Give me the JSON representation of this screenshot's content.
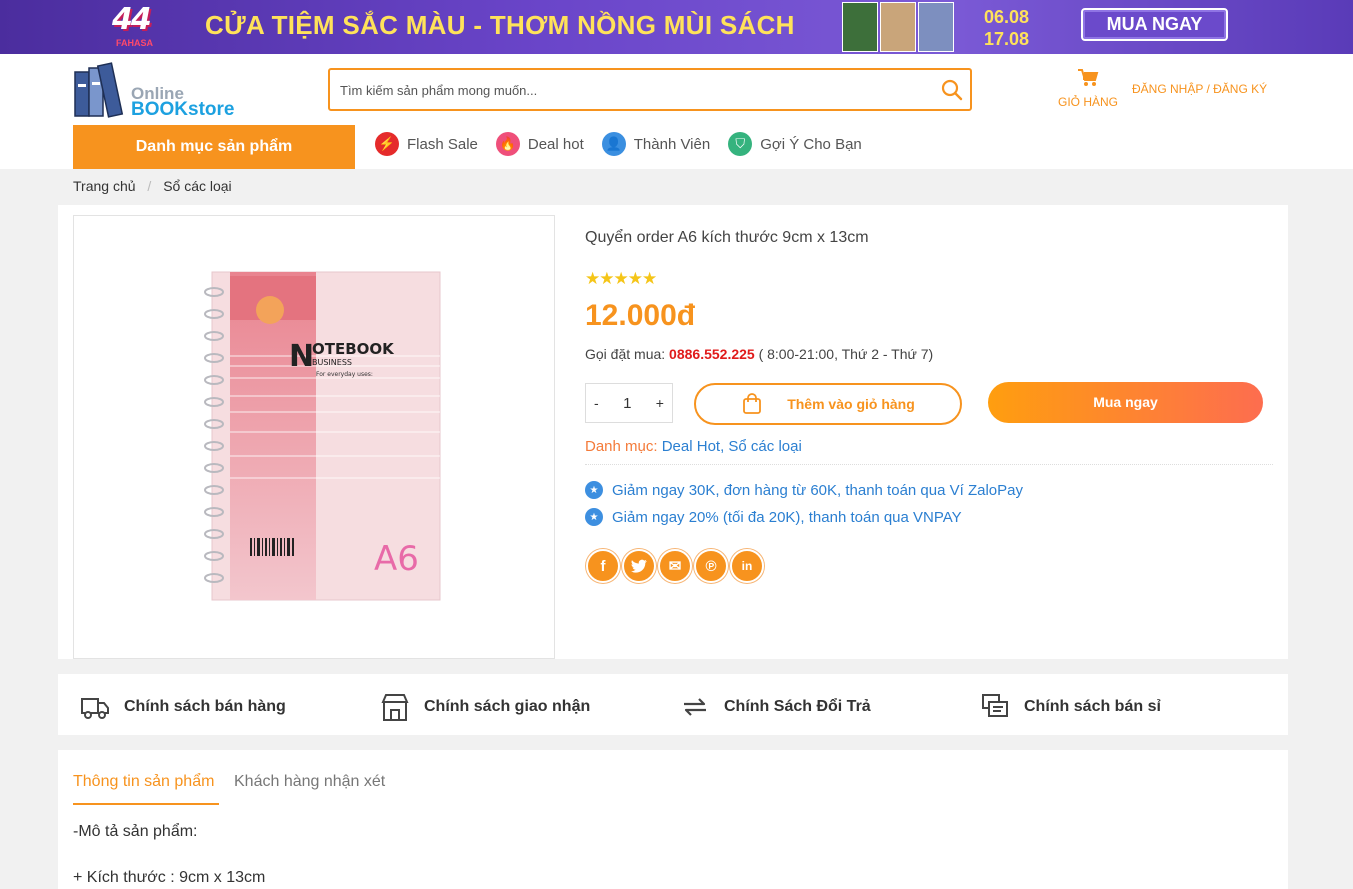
{
  "banner": {
    "number": "44",
    "brand": "FAHASA",
    "slogan": "CỬA TIỆM SẮC MÀU - THƠM NỒNG MÙI SÁCH",
    "date_start": "06.08",
    "date_end": "17.08",
    "cta": "MUA NGAY"
  },
  "header": {
    "logo_line1": "Online",
    "logo_line2": "BOOKstore",
    "search_placeholder": "Tìm kiếm sản phẩm mong muốn...",
    "cart_label": "GIỎ HÀNG",
    "login_label": "ĐĂNG NHẬP / ĐĂNG KÝ",
    "category_button": "Danh mục sản phẩm",
    "nav": [
      {
        "label": "Flash Sale",
        "icon": "lightning-icon",
        "color": "#e52b2b"
      },
      {
        "label": "Deal hot",
        "icon": "fire-icon",
        "color": "#ef4f7a"
      },
      {
        "label": "Thành Viên",
        "icon": "user-icon",
        "color": "#3b8fe0"
      },
      {
        "label": "Gợi Ý Cho Bạn",
        "icon": "shield-icon",
        "color": "#35b37e"
      }
    ]
  },
  "breadcrumb": {
    "home": "Trang chủ",
    "current": "Sổ các loại"
  },
  "product": {
    "title": "Quyển order A6 kích thước 9cm x 13cm",
    "rating": "★★★★★",
    "price": "12.000đ",
    "phone_label": "Gọi đặt mua:",
    "phone_number": "0886.552.225",
    "phone_hours": "( 8:00-21:00, Thứ 2 - Thứ 7)",
    "quantity": "1",
    "qty_minus": "-",
    "qty_plus": "+",
    "add_to_cart": "Thêm vào giỏ hàng",
    "buy_now": "Mua ngay",
    "category_label": "Danh mục:",
    "category_1": "Deal Hot",
    "category_sep": ",",
    "category_2": "Sổ các loại",
    "promos": [
      "Giảm ngay 30K, đơn hàng từ 60K, thanh toán qua Ví ZaloPay",
      "Giảm ngay 20% (tối đa 20K), thanh toán qua VNPAY"
    ],
    "share": [
      {
        "icon": "facebook-icon",
        "glyph": "f"
      },
      {
        "icon": "twitter-icon",
        "glyph": "🐦"
      },
      {
        "icon": "email-icon",
        "glyph": "✉"
      },
      {
        "icon": "pinterest-icon",
        "glyph": "℗"
      },
      {
        "icon": "linkedin-icon",
        "glyph": "in"
      }
    ],
    "image_text": {
      "notebook": "OTEBOOK",
      "notebook_n": "N",
      "business": "BUSINESS",
      "uses": "For everyday uses:",
      "size": "A6"
    }
  },
  "policies": [
    {
      "label": "Chính sách bán hàng",
      "icon": "truck-icon"
    },
    {
      "label": "Chính sách giao nhận",
      "icon": "store-icon"
    },
    {
      "label": "Chính Sách Đổi Trả",
      "icon": "exchange-icon"
    },
    {
      "label": "Chính sách bán sỉ",
      "icon": "chat-icon"
    }
  ],
  "tabs": {
    "active": "Thông tin sản phẩm",
    "inactive": "Khách hàng nhận xét"
  },
  "description": {
    "line1": "-Mô tả sản phẩm:",
    "line2": "+ Kích thước : 9cm x 13cm"
  },
  "colors": {
    "accent": "#f7931e",
    "phone": "#e01b1b",
    "link": "#2b7fd1"
  }
}
